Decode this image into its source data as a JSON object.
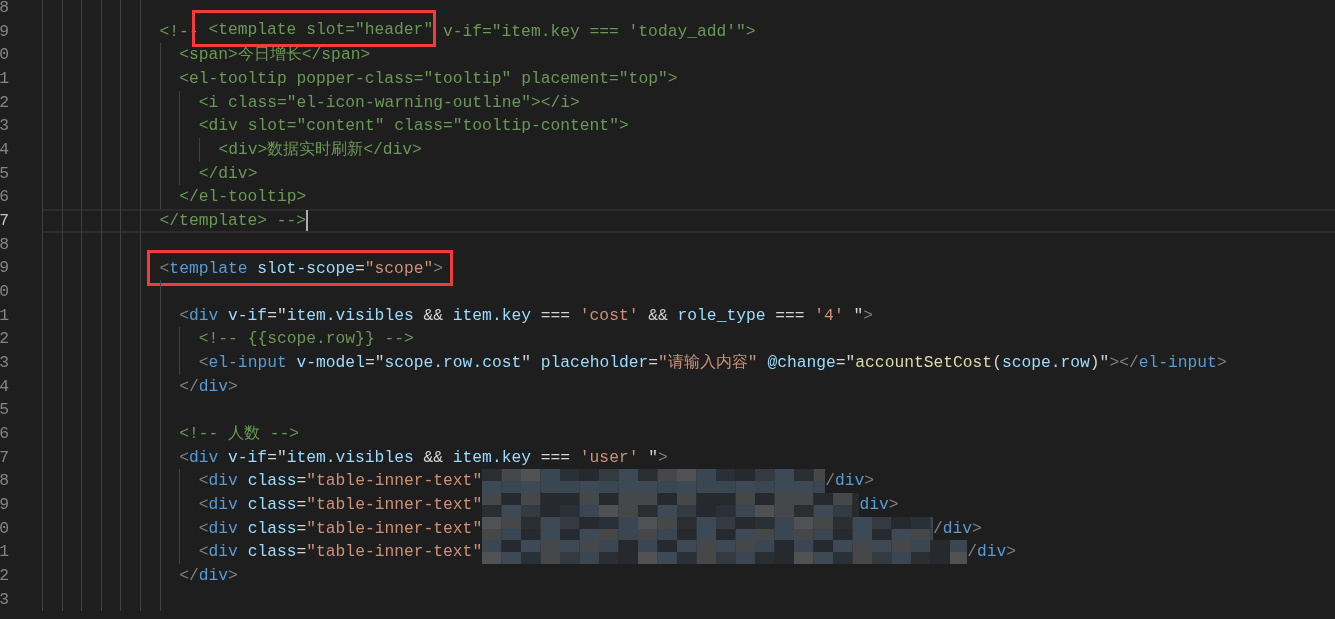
{
  "editor": {
    "lines": [
      {
        "number": "8",
        "cursor": false
      },
      {
        "number": "9",
        "cursor": false,
        "tokens": [
          {
            "kind": "comment",
            "text": "<!--",
            "boxed": false
          },
          {
            "kind": "comment",
            "text": " <template slot=\"header\"",
            "boxed": true
          },
          {
            "kind": "comment",
            "text": " v-if=\"item.key === 'today_add'\">",
            "boxed": false
          }
        ],
        "children": [
          {
            "number": "0",
            "cursor": false,
            "tokens": [
              {
                "kind": "comment",
                "text": "<span>今日增长</span>"
              }
            ]
          },
          {
            "number": "1",
            "cursor": false,
            "tokens": [
              {
                "kind": "comment",
                "text": "<el-tooltip popper-class=\"tooltip\" placement=\"top\">"
              }
            ],
            "children": [
              {
                "number": "2",
                "cursor": false,
                "tokens": [
                  {
                    "kind": "comment",
                    "text": "<i class=\"el-icon-warning-outline\"></i>"
                  }
                ]
              },
              {
                "number": "3",
                "cursor": false,
                "tokens": [
                  {
                    "kind": "comment",
                    "text": "<div slot=\"content\" class=\"tooltip-content\">"
                  }
                ],
                "children": [
                  {
                    "number": "4",
                    "cursor": false,
                    "tokens": [
                      {
                        "kind": "comment",
                        "text": "<div>数据实时刷新</div>"
                      }
                    ]
                  }
                ]
              },
              {
                "number": "5",
                "cursor": false,
                "tokens": [
                  {
                    "kind": "comment",
                    "text": "</div>"
                  }
                ]
              }
            ]
          },
          {
            "number": "6",
            "cursor": false,
            "tokens": [
              {
                "kind": "comment",
                "text": "</el-tooltip>"
              }
            ]
          }
        ]
      },
      {
        "number": "7",
        "cursor": true,
        "tokens": [
          {
            "kind": "comment",
            "text": "</template> -->"
          }
        ]
      },
      {
        "number": "8",
        "cursor": false
      },
      {
        "number": "9",
        "cursor": false,
        "boxed": true,
        "tokens": [
          {
            "kind": "punct",
            "text": "<"
          },
          {
            "kind": "tag",
            "text": "template"
          },
          {
            "kind": "attr",
            "text": " slot-scope"
          },
          {
            "kind": "text",
            "text": "="
          },
          {
            "kind": "str",
            "text": "\"scope\""
          },
          {
            "kind": "punct",
            "text": ">"
          }
        ],
        "children": [
          {
            "number": "0",
            "cursor": false
          },
          {
            "number": "1",
            "cursor": false,
            "tokens": [
              {
                "kind": "punct",
                "text": "<"
              },
              {
                "kind": "tag",
                "text": "div"
              },
              {
                "kind": "attr",
                "text": " v-if"
              },
              {
                "kind": "text",
                "text": "=\""
              },
              {
                "kind": "var",
                "text": "item.visibles"
              },
              {
                "kind": "text",
                "text": " && "
              },
              {
                "kind": "var",
                "text": "item.key"
              },
              {
                "kind": "text",
                "text": " === "
              },
              {
                "kind": "str",
                "text": "'cost'"
              },
              {
                "kind": "text",
                "text": " && "
              },
              {
                "kind": "var",
                "text": "role_type"
              },
              {
                "kind": "text",
                "text": " === "
              },
              {
                "kind": "str",
                "text": "'4'"
              },
              {
                "kind": "text",
                "text": " \""
              },
              {
                "kind": "punct",
                "text": ">"
              }
            ],
            "children": [
              {
                "number": "2",
                "cursor": false,
                "tokens": [
                  {
                    "kind": "comment",
                    "text": "<!-- {{scope.row}} -->"
                  }
                ]
              },
              {
                "number": "3",
                "cursor": false,
                "tokens": [
                  {
                    "kind": "punct",
                    "text": "<"
                  },
                  {
                    "kind": "tag",
                    "text": "el-input"
                  },
                  {
                    "kind": "attr",
                    "text": " v-model"
                  },
                  {
                    "kind": "text",
                    "text": "=\""
                  },
                  {
                    "kind": "var",
                    "text": "scope.row.cost"
                  },
                  {
                    "kind": "text",
                    "text": "\""
                  },
                  {
                    "kind": "attr",
                    "text": " placeholder"
                  },
                  {
                    "kind": "text",
                    "text": "="
                  },
                  {
                    "kind": "str",
                    "text": "\"请输入内容\""
                  },
                  {
                    "kind": "attr",
                    "text": " @change"
                  },
                  {
                    "kind": "text",
                    "text": "=\""
                  },
                  {
                    "kind": "fn",
                    "text": "accountSetCost"
                  },
                  {
                    "kind": "text",
                    "text": "("
                  },
                  {
                    "kind": "var",
                    "text": "scope.row"
                  },
                  {
                    "kind": "text",
                    "text": ")\""
                  },
                  {
                    "kind": "punct",
                    "text": "></"
                  },
                  {
                    "kind": "tag",
                    "text": "el-input"
                  },
                  {
                    "kind": "punct",
                    "text": ">"
                  }
                ]
              }
            ]
          },
          {
            "number": "4",
            "cursor": false,
            "tokens": [
              {
                "kind": "punct",
                "text": "</"
              },
              {
                "kind": "tag",
                "text": "div"
              },
              {
                "kind": "punct",
                "text": ">"
              }
            ]
          },
          {
            "number": "5",
            "cursor": false
          },
          {
            "number": "6",
            "cursor": false,
            "tokens": [
              {
                "kind": "comment",
                "text": "<!-- 人数 -->"
              }
            ]
          },
          {
            "number": "7",
            "cursor": false,
            "tokens": [
              {
                "kind": "punct",
                "text": "<"
              },
              {
                "kind": "tag",
                "text": "div"
              },
              {
                "kind": "attr",
                "text": " v-if"
              },
              {
                "kind": "text",
                "text": "=\""
              },
              {
                "kind": "var",
                "text": "item.visibles"
              },
              {
                "kind": "text",
                "text": " && "
              },
              {
                "kind": "var",
                "text": "item.key"
              },
              {
                "kind": "text",
                "text": " === "
              },
              {
                "kind": "str",
                "text": "'user'"
              },
              {
                "kind": "text",
                "text": " \""
              },
              {
                "kind": "punct",
                "text": ">"
              }
            ],
            "children": [
              {
                "number": "8",
                "cursor": false,
                "redacted": true,
                "tokens": [
                  {
                    "kind": "punct",
                    "text": "<"
                  },
                  {
                    "kind": "tag",
                    "text": "div"
                  },
                  {
                    "kind": "attr",
                    "text": " class"
                  },
                  {
                    "kind": "text",
                    "text": "="
                  },
                  {
                    "kind": "str",
                    "text": "\"table-inner-text\""
                  }
                ],
                "tail": [
                  {
                    "kind": "punct",
                    "text": "/"
                  },
                  {
                    "kind": "tag",
                    "text": "div"
                  },
                  {
                    "kind": "punct",
                    "text": ">"
                  }
                ]
              },
              {
                "number": "9",
                "cursor": false,
                "redacted": true,
                "tokens": [
                  {
                    "kind": "punct",
                    "text": "<"
                  },
                  {
                    "kind": "tag",
                    "text": "div"
                  },
                  {
                    "kind": "attr",
                    "text": " class"
                  },
                  {
                    "kind": "text",
                    "text": "="
                  },
                  {
                    "kind": "str",
                    "text": "\"table-inner-text\""
                  }
                ],
                "tail": [
                  {
                    "kind": "tag",
                    "text": "div"
                  },
                  {
                    "kind": "punct",
                    "text": ">"
                  }
                ]
              },
              {
                "number": "0",
                "cursor": false,
                "redacted": true,
                "tokens": [
                  {
                    "kind": "punct",
                    "text": "<"
                  },
                  {
                    "kind": "tag",
                    "text": "div"
                  },
                  {
                    "kind": "attr",
                    "text": " class"
                  },
                  {
                    "kind": "text",
                    "text": "="
                  },
                  {
                    "kind": "str",
                    "text": "\"table-inner-text\""
                  }
                ],
                "tail": [
                  {
                    "kind": "punct",
                    "text": "/"
                  },
                  {
                    "kind": "tag",
                    "text": "div"
                  },
                  {
                    "kind": "punct",
                    "text": ">"
                  }
                ]
              },
              {
                "number": "1",
                "cursor": false,
                "redacted": true,
                "tokens": [
                  {
                    "kind": "punct",
                    "text": "<"
                  },
                  {
                    "kind": "tag",
                    "text": "div"
                  },
                  {
                    "kind": "attr",
                    "text": " class"
                  },
                  {
                    "kind": "text",
                    "text": "="
                  },
                  {
                    "kind": "str",
                    "text": "\"table-inner-text\""
                  }
                ],
                "tail": [
                  {
                    "kind": "punct",
                    "text": "/"
                  },
                  {
                    "kind": "tag",
                    "text": "div"
                  },
                  {
                    "kind": "punct",
                    "text": ">"
                  }
                ]
              }
            ]
          },
          {
            "number": "2",
            "cursor": false,
            "tokens": [
              {
                "kind": "punct",
                "text": "</"
              },
              {
                "kind": "tag",
                "text": "div"
              },
              {
                "kind": "punct",
                "text": ">"
              }
            ]
          },
          {
            "number": "3",
            "cursor": false
          }
        ]
      }
    ]
  }
}
